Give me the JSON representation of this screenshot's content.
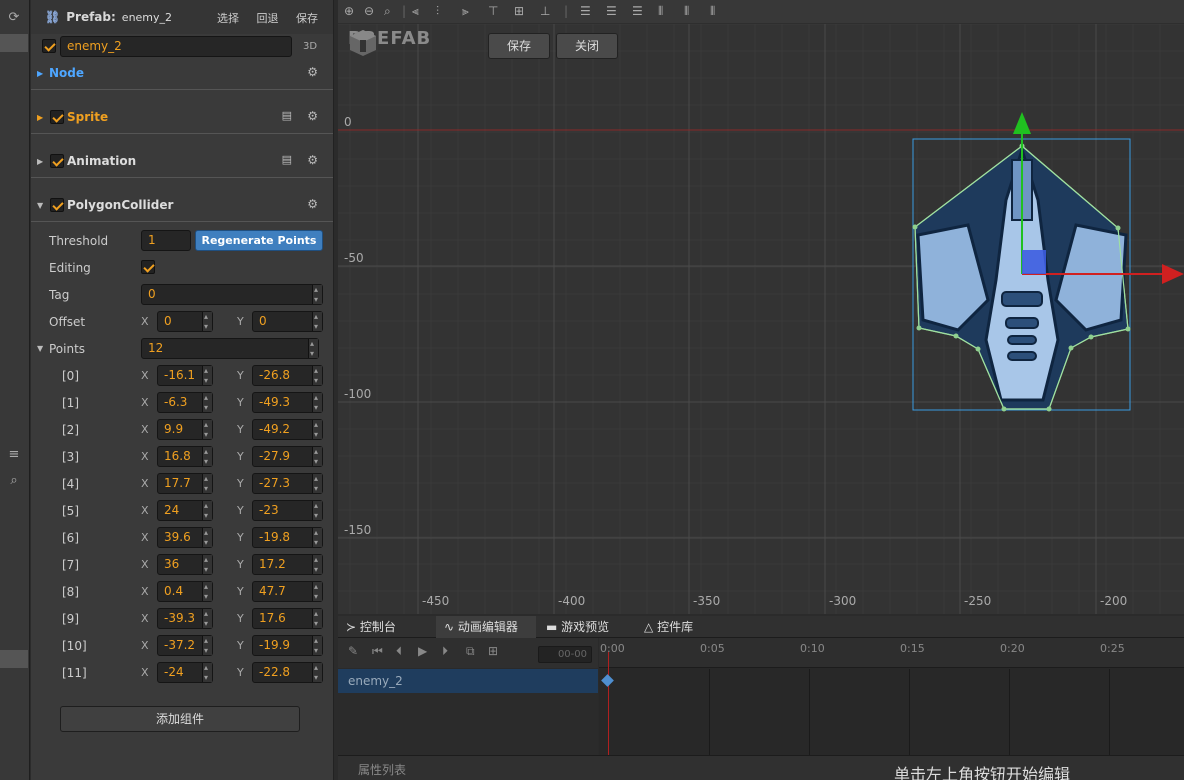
{
  "inspector": {
    "prefab_label": "Prefab:",
    "prefab_name": "enemy_2",
    "actions": {
      "select": "选择",
      "revert": "回退",
      "save": "保存"
    },
    "node_name": "enemy_2",
    "badge_3d": "3D",
    "sections": {
      "node": "Node",
      "sprite": "Sprite",
      "animation": "Animation",
      "polygon": "PolygonCollider"
    },
    "polygon": {
      "threshold_label": "Threshold",
      "threshold_value": "1",
      "regen_label": "Regenerate Points",
      "editing_label": "Editing",
      "tag_label": "Tag",
      "tag_value": "0",
      "offset_label": "Offset",
      "offset_x": "0",
      "offset_y": "0",
      "points_label": "Points",
      "points_count": "12",
      "points": [
        {
          "i": "[0]",
          "x": "-16.1",
          "y": "-26.8"
        },
        {
          "i": "[1]",
          "x": "-6.3",
          "y": "-49.3"
        },
        {
          "i": "[2]",
          "x": "9.9",
          "y": "-49.2"
        },
        {
          "i": "[3]",
          "x": "16.8",
          "y": "-27.9"
        },
        {
          "i": "[4]",
          "x": "17.7",
          "y": "-27.3"
        },
        {
          "i": "[5]",
          "x": "24",
          "y": "-23"
        },
        {
          "i": "[6]",
          "x": "39.6",
          "y": "-19.8"
        },
        {
          "i": "[7]",
          "x": "36",
          "y": "17.2"
        },
        {
          "i": "[8]",
          "x": "0.4",
          "y": "47.7"
        },
        {
          "i": "[9]",
          "x": "-39.3",
          "y": "17.6"
        },
        {
          "i": "[10]",
          "x": "-37.2",
          "y": "-19.9"
        },
        {
          "i": "[11]",
          "x": "-24",
          "y": "-22.8"
        }
      ]
    },
    "xlabel": "X",
    "ylabel": "Y",
    "add_component": "添加组件"
  },
  "scene": {
    "mode_label": "PREFAB",
    "save_btn": "保存",
    "close_btn": "关闭",
    "y_ticks": [
      "0",
      "-50",
      "-100",
      "-150"
    ],
    "x_ticks": [
      "-450",
      "-400",
      "-350",
      "-300",
      "-250",
      "-200"
    ]
  },
  "bottom": {
    "tabs": {
      "console": "控制台",
      "anim": "动画编辑器",
      "preview": "游戏预览",
      "widgets": "控件库"
    },
    "time_field": "00-00",
    "node": "enemy_2",
    "ruler": [
      "0:00",
      "0:05",
      "0:10",
      "0:15",
      "0:20",
      "0:25"
    ],
    "props_label": "属性列表",
    "hint": "单击左上角按钮开始编辑"
  },
  "colors": {
    "accent": "#f0a020",
    "blue": "#3f7fbf",
    "node_section": "#4ea6ff"
  }
}
